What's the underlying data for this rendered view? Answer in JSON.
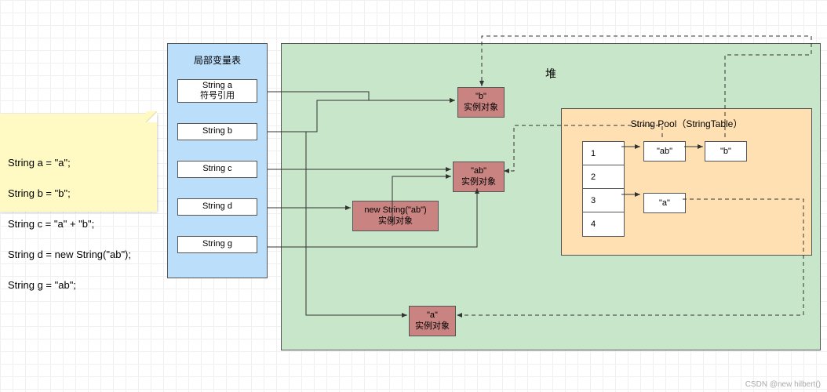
{
  "note": {
    "line1": "String a = \"a\";",
    "line2": "String b = \"b\";",
    "line3": "String c = \"a\" + \"b\";",
    "line4": "String d = new String(\"ab\");",
    "line5": "String g = \"ab\";"
  },
  "lvt": {
    "title": "局部变量表",
    "items": {
      "a": "String a\n符号引用",
      "b": "String b",
      "c": "String c",
      "d": "String d",
      "g": "String g"
    }
  },
  "heap": {
    "title": "堆",
    "obj_b": "\"b\"\n实例对象",
    "obj_ab": "\"ab\"\n实例对象",
    "obj_newstr": "new String(\"ab\")\n实例对象",
    "obj_a": "\"a\"\n实例对象"
  },
  "pool": {
    "title": "String Pool（StringTable）",
    "rows": {
      "r1": "1",
      "r2": "2",
      "r3": "3",
      "r4": "4"
    },
    "cell_ab": "\"ab\"",
    "cell_b": "\"b\"",
    "cell_a": "\"a\""
  },
  "watermark": "CSDN @new hilbert()"
}
